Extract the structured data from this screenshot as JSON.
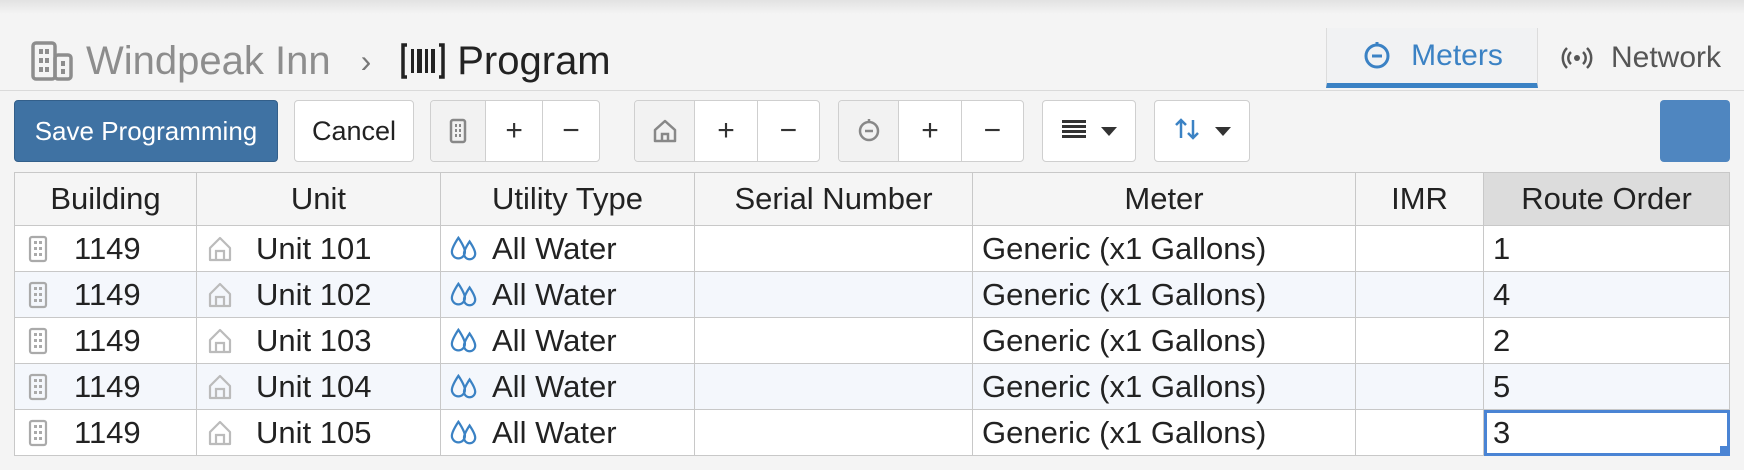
{
  "breadcrumb": {
    "building_name": "Windpeak Inn",
    "separator": "›",
    "page_title": "Program"
  },
  "tabs": [
    {
      "label": "Meters",
      "active": true,
      "icon": "meter-icon"
    },
    {
      "label": "Network",
      "active": false,
      "icon": "broadcast-icon"
    }
  ],
  "toolbar": {
    "save_label": "Save Programming",
    "cancel_label": "Cancel",
    "building_group": {
      "icon": "building-icon",
      "add": "+",
      "remove": "−"
    },
    "unit_group": {
      "icon": "home-icon",
      "add": "+",
      "remove": "−"
    },
    "meter_group": {
      "icon": "meter-icon",
      "add": "+",
      "remove": "−"
    },
    "align_dropdown_icon": "align-icon",
    "sort_dropdown_icon": "sort-icon",
    "accent_color": "#4f86c0"
  },
  "table": {
    "columns": [
      "Building",
      "Unit",
      "Utility Type",
      "Serial Number",
      "Meter",
      "IMR",
      "Route Order"
    ],
    "rows": [
      {
        "building": "1149",
        "unit": "Unit 101",
        "utility": "All Water",
        "serial": "",
        "meter": "Generic (x1 Gallons)",
        "imr": "",
        "route": "1"
      },
      {
        "building": "1149",
        "unit": "Unit 102",
        "utility": "All Water",
        "serial": "",
        "meter": "Generic (x1 Gallons)",
        "imr": "",
        "route": "4"
      },
      {
        "building": "1149",
        "unit": "Unit 103",
        "utility": "All Water",
        "serial": "",
        "meter": "Generic (x1 Gallons)",
        "imr": "",
        "route": "2"
      },
      {
        "building": "1149",
        "unit": "Unit 104",
        "utility": "All Water",
        "serial": "",
        "meter": "Generic (x1 Gallons)",
        "imr": "",
        "route": "5"
      },
      {
        "building": "1149",
        "unit": "Unit 105",
        "utility": "All Water",
        "serial": "",
        "meter": "Generic (x1 Gallons)",
        "imr": "",
        "route": "3"
      }
    ]
  },
  "colors": {
    "primary": "#3f72a3",
    "tab_active": "#3b82c4",
    "selection": "#4a84d4",
    "water_icon": "#3b82c4"
  }
}
